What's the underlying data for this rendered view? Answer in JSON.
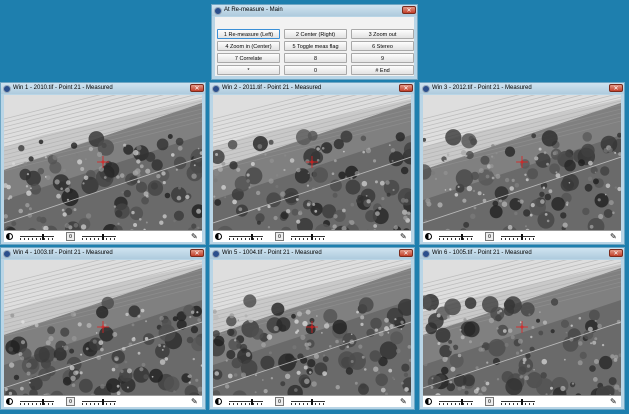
{
  "keypad": {
    "title": "At Re-measure - Main",
    "close_label": "✕",
    "buttons": [
      [
        "1 Re-measure (Left)",
        "2 Center (Right)",
        "3 Zoom out"
      ],
      [
        "4 Zoom in (Center)",
        "5 Toggle meas flag",
        "6 Stereo"
      ],
      [
        "7 Correlate",
        "8",
        "9"
      ],
      [
        "*",
        "0",
        "# End"
      ]
    ]
  },
  "windows": [
    {
      "title": "Win 1 - 2010.tif - Point 21 - Measured"
    },
    {
      "title": "Win 2 - 2011.tif - Point 21 - Measured"
    },
    {
      "title": "Win 3 - 2012.tif - Point 21 - Measured"
    },
    {
      "title": "Win 4 - 1003.tif - Point 21 - Measured"
    },
    {
      "title": "Win 5 - 1004.tif - Point 21 - Measured"
    },
    {
      "title": "Win 6 - 1005.tif - Point 21 - Measured"
    }
  ],
  "window_close_label": "✕",
  "toolbar": {
    "reset_label": "¤",
    "pick_label": "✎",
    "icons": [
      "contrast-icon",
      "brightness-slider",
      "reset-icon",
      "zoom-slider",
      "eyedropper-icon"
    ]
  },
  "colors": {
    "desktop": "#1e7fae",
    "measure_cross": "#e02020"
  }
}
